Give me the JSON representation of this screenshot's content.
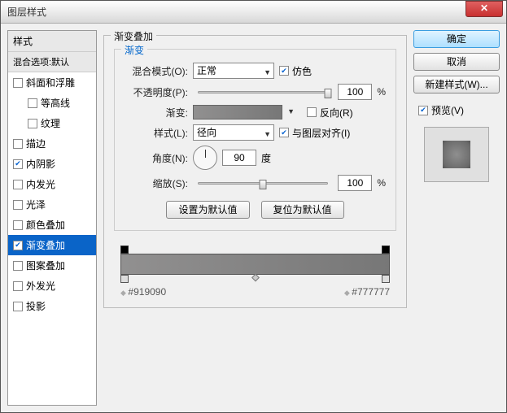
{
  "window": {
    "title": "图层样式"
  },
  "left": {
    "header": "样式",
    "sub": "混合选项:默认",
    "items": [
      {
        "label": "斜面和浮雕",
        "checked": false
      },
      {
        "label": "等高线",
        "checked": false,
        "indent": true
      },
      {
        "label": "纹理",
        "checked": false,
        "indent": true
      },
      {
        "label": "描边",
        "checked": false
      },
      {
        "label": "内阴影",
        "checked": true
      },
      {
        "label": "内发光",
        "checked": false
      },
      {
        "label": "光泽",
        "checked": false
      },
      {
        "label": "颜色叠加",
        "checked": false
      },
      {
        "label": "渐变叠加",
        "checked": true,
        "selected": true
      },
      {
        "label": "图案叠加",
        "checked": false
      },
      {
        "label": "外发光",
        "checked": false
      },
      {
        "label": "投影",
        "checked": false
      }
    ]
  },
  "main": {
    "group_title": "渐变叠加",
    "inner_title": "渐变",
    "blend_label": "混合模式(O):",
    "blend_value": "正常",
    "dither_label": "仿色",
    "opacity_label": "不透明度(P):",
    "opacity_value": "100",
    "pct": "%",
    "gradient_label": "渐变:",
    "reverse_label": "反向(R)",
    "style_label": "样式(L):",
    "style_value": "径向",
    "align_label": "与图层对齐(I)",
    "angle_label": "角度(N):",
    "angle_value": "90",
    "angle_unit": "度",
    "scale_label": "缩放(S):",
    "scale_value": "100",
    "btn_default": "设置为默认值",
    "btn_reset": "复位为默认值",
    "grad_left": "#919090",
    "grad_right": "#777777"
  },
  "right": {
    "ok": "确定",
    "cancel": "取消",
    "newstyle": "新建样式(W)...",
    "preview_label": "预览(V)"
  },
  "chart_data": {
    "type": "gradient",
    "stops": [
      {
        "position": 0,
        "color": "#919090"
      },
      {
        "position": 100,
        "color": "#777777"
      }
    ]
  }
}
